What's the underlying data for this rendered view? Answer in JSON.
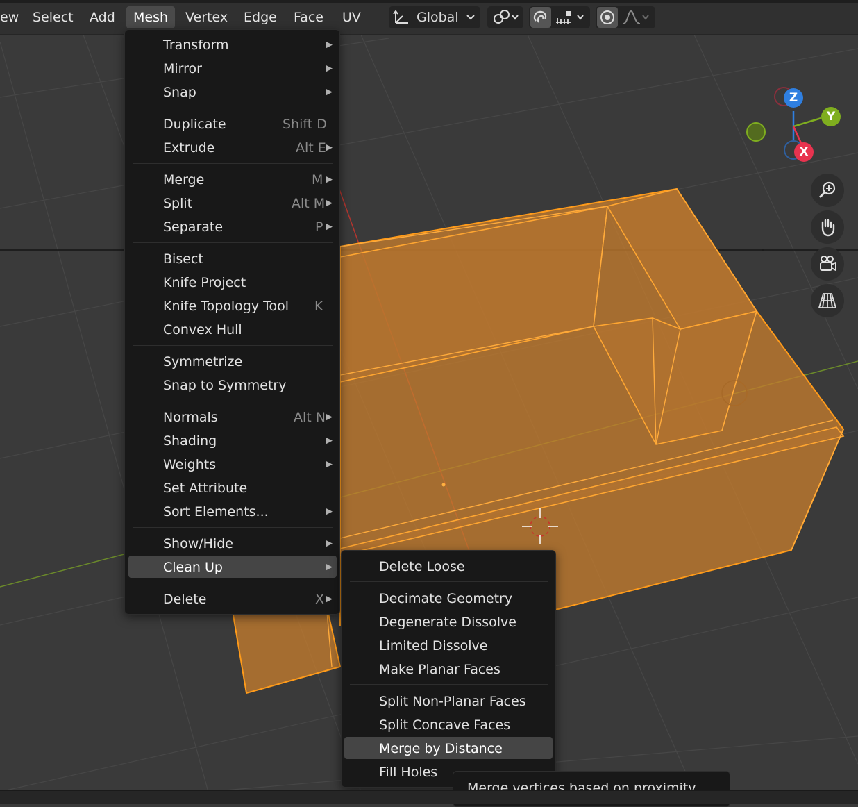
{
  "header": {
    "menus": [
      {
        "label": "ew",
        "active": false
      },
      {
        "label": "Select",
        "active": false
      },
      {
        "label": "Add",
        "active": false
      },
      {
        "label": "Mesh",
        "active": true
      },
      {
        "label": "Vertex",
        "active": false
      },
      {
        "label": "Edge",
        "active": false
      },
      {
        "label": "Face",
        "active": false
      },
      {
        "label": "UV",
        "active": false
      }
    ],
    "transform_orientation": "Global",
    "icons": [
      "transform-axes-icon",
      "chevron-down-icon",
      "pivot-link-icon",
      "snap-magnet-icon",
      "snap-increment-icon",
      "proportional-edit-icon",
      "falloff-curve-icon"
    ]
  },
  "mesh_menu": {
    "items": [
      {
        "label": "Transform",
        "shortcut": "",
        "submenu": true,
        "sep_before": false
      },
      {
        "label": "Mirror",
        "shortcut": "",
        "submenu": true,
        "sep_before": false
      },
      {
        "label": "Snap",
        "shortcut": "",
        "submenu": true,
        "sep_before": false
      },
      {
        "label": "Duplicate",
        "shortcut": "Shift D",
        "submenu": false,
        "sep_before": true
      },
      {
        "label": "Extrude",
        "shortcut": "Alt E",
        "submenu": true,
        "sep_before": false
      },
      {
        "label": "Merge",
        "shortcut": "M",
        "submenu": true,
        "sep_before": true
      },
      {
        "label": "Split",
        "shortcut": "Alt M",
        "submenu": true,
        "sep_before": false
      },
      {
        "label": "Separate",
        "shortcut": "P",
        "submenu": true,
        "sep_before": false
      },
      {
        "label": "Bisect",
        "shortcut": "",
        "submenu": false,
        "sep_before": true
      },
      {
        "label": "Knife Project",
        "shortcut": "",
        "submenu": false,
        "sep_before": false
      },
      {
        "label": "Knife Topology Tool",
        "shortcut": "K",
        "submenu": false,
        "sep_before": false
      },
      {
        "label": "Convex Hull",
        "shortcut": "",
        "submenu": false,
        "sep_before": false
      },
      {
        "label": "Symmetrize",
        "shortcut": "",
        "submenu": false,
        "sep_before": true
      },
      {
        "label": "Snap to Symmetry",
        "shortcut": "",
        "submenu": false,
        "sep_before": false
      },
      {
        "label": "Normals",
        "shortcut": "Alt N",
        "submenu": true,
        "sep_before": true
      },
      {
        "label": "Shading",
        "shortcut": "",
        "submenu": true,
        "sep_before": false
      },
      {
        "label": "Weights",
        "shortcut": "",
        "submenu": true,
        "sep_before": false
      },
      {
        "label": "Set Attribute",
        "shortcut": "",
        "submenu": false,
        "sep_before": false
      },
      {
        "label": "Sort Elements...",
        "shortcut": "",
        "submenu": true,
        "sep_before": false
      },
      {
        "label": "Show/Hide",
        "shortcut": "",
        "submenu": true,
        "sep_before": true
      },
      {
        "label": "Clean Up",
        "shortcut": "",
        "submenu": true,
        "sep_before": false,
        "highlighted": true
      },
      {
        "label": "Delete",
        "shortcut": "X",
        "submenu": true,
        "sep_before": true
      }
    ]
  },
  "cleanup_menu": {
    "items": [
      {
        "label": "Delete Loose",
        "sep_before": false
      },
      {
        "label": "Decimate Geometry",
        "sep_before": true
      },
      {
        "label": "Degenerate Dissolve",
        "sep_before": false
      },
      {
        "label": "Limited Dissolve",
        "sep_before": false
      },
      {
        "label": "Make Planar Faces",
        "sep_before": false
      },
      {
        "label": "Split Non-Planar Faces",
        "sep_before": true
      },
      {
        "label": "Split Concave Faces",
        "sep_before": false
      },
      {
        "label": "Merge by Distance",
        "sep_before": false,
        "highlighted": true
      },
      {
        "label": "Fill Holes",
        "sep_before": false
      }
    ]
  },
  "tooltip": {
    "text": "Merge vertices based on proximity."
  },
  "gizmo": {
    "axes": [
      {
        "label": "Z",
        "color": "#2f7fe0"
      },
      {
        "label": "Y",
        "color": "#7fae1f"
      },
      {
        "label": "X",
        "color": "#e8334f"
      }
    ]
  },
  "nav_buttons": [
    "zoom-icon",
    "hand-pan-icon",
    "camera-icon",
    "perspective-grid-icon"
  ],
  "colors": {
    "selection_orange": "#ff9b1a",
    "viewport_bg": "#3a3a3a",
    "menu_bg": "#181818",
    "highlight": "#454545"
  }
}
